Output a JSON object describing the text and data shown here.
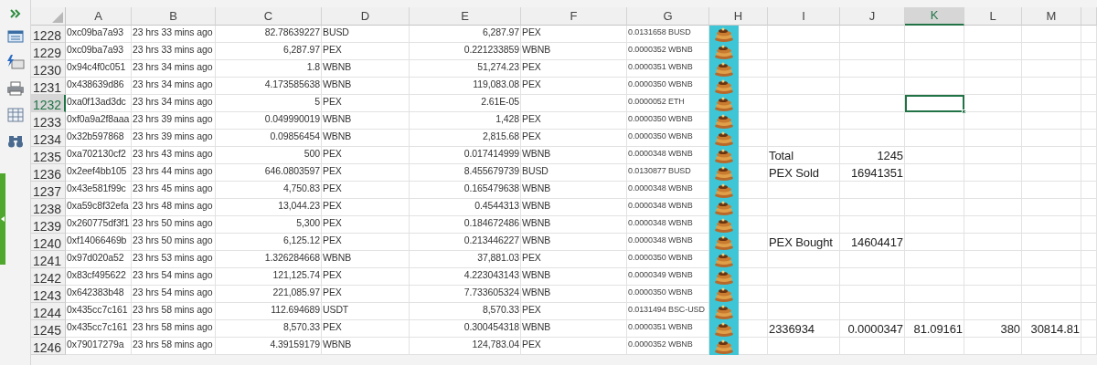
{
  "columns": [
    {
      "label": "A",
      "selected": false
    },
    {
      "label": "B",
      "selected": false
    },
    {
      "label": "C",
      "selected": false
    },
    {
      "label": "D",
      "selected": false
    },
    {
      "label": "E",
      "selected": false
    },
    {
      "label": "F",
      "selected": false
    },
    {
      "label": "G",
      "selected": false
    },
    {
      "label": "H",
      "selected": false
    },
    {
      "label": "I",
      "selected": false
    },
    {
      "label": "J",
      "selected": false
    },
    {
      "label": "K",
      "selected": true
    },
    {
      "label": "L",
      "selected": false
    },
    {
      "label": "M",
      "selected": false
    }
  ],
  "rows": [
    {
      "number": "1228",
      "selected": false,
      "cells": {
        "a": "0xc09ba7a93",
        "b": "23 hrs 33 mins ago",
        "c": "82.78639227",
        "d": "BUSD",
        "e": "6,287.97",
        "f": "PEX",
        "g": "0.0131658 BUSD"
      }
    },
    {
      "number": "1229",
      "selected": false,
      "cells": {
        "a": "0xc09ba7a93",
        "b": "23 hrs 33 mins ago",
        "c": "6,287.97",
        "d": "PEX",
        "e": "0.221233859",
        "f": "WBNB",
        "g": "0.0000352 WBNB"
      }
    },
    {
      "number": "1230",
      "selected": false,
      "cells": {
        "a": "0x94c4f0c051",
        "b": "23 hrs 34 mins ago",
        "c": "1.8",
        "d": "WBNB",
        "e": "51,274.23",
        "f": "PEX",
        "g": "0.0000351 WBNB"
      }
    },
    {
      "number": "1231",
      "selected": false,
      "cells": {
        "a": "0x438639d86",
        "b": "23 hrs 34 mins ago",
        "c": "4.173585638",
        "d": "WBNB",
        "e": "119,083.08",
        "f": "PEX",
        "g": "0.0000350 WBNB"
      }
    },
    {
      "number": "1232",
      "selected": true,
      "cells": {
        "a": "0xa0f13ad3dc",
        "b": "23 hrs 34 mins ago",
        "c": "5",
        "d": "PEX",
        "e": "2.61E-05",
        "g": "0.0000052 ETH"
      }
    },
    {
      "number": "1233",
      "selected": false,
      "cells": {
        "a": "0xf0a9a2f8aaa",
        "b": "23 hrs 39 mins ago",
        "c": "0.049990019",
        "d": "WBNB",
        "e": "1,428",
        "f": "PEX",
        "g": "0.0000350 WBNB"
      }
    },
    {
      "number": "1234",
      "selected": false,
      "cells": {
        "a": "0x32b597868",
        "b": "23 hrs 39 mins ago",
        "c": "0.09856454",
        "d": "WBNB",
        "e": "2,815.68",
        "f": "PEX",
        "g": "0.0000350 WBNB"
      }
    },
    {
      "number": "1235",
      "selected": false,
      "cells": {
        "a": "0xa702130cf2",
        "b": "23 hrs 43 mins ago",
        "c": "500",
        "d": "PEX",
        "e": "0.017414999",
        "f": "WBNB",
        "g": "0.0000348 WBNB",
        "i": "Total",
        "j": "1245"
      }
    },
    {
      "number": "1236",
      "selected": false,
      "cells": {
        "a": "0x2eef4bb105",
        "b": "23 hrs 44 mins ago",
        "c": "646.0803597",
        "d": "PEX",
        "e": "8.455679739",
        "f": "BUSD",
        "g": "0.0130877 BUSD",
        "i": "PEX Sold",
        "j": "16941351"
      }
    },
    {
      "number": "1237",
      "selected": false,
      "cells": {
        "a": "0x43e581f99c",
        "b": "23 hrs 45 mins ago",
        "c": "4,750.83",
        "d": "PEX",
        "e": "0.165479638",
        "f": "WBNB",
        "g": "0.0000348 WBNB"
      }
    },
    {
      "number": "1238",
      "selected": false,
      "cells": {
        "a": "0xa59c8f32efa",
        "b": "23 hrs 48 mins ago",
        "c": "13,044.23",
        "d": "PEX",
        "e": "0.4544313",
        "f": "WBNB",
        "g": "0.0000348 WBNB"
      }
    },
    {
      "number": "1239",
      "selected": false,
      "cells": {
        "a": "0x260775df3f1",
        "b": "23 hrs 50 mins ago",
        "c": "5,300",
        "d": "PEX",
        "e": "0.184672486",
        "f": "WBNB",
        "g": "0.0000348 WBNB"
      }
    },
    {
      "number": "1240",
      "selected": false,
      "cells": {
        "a": "0xf14066469b",
        "b": "23 hrs 50 mins ago",
        "c": "6,125.12",
        "d": "PEX",
        "e": "0.213446227",
        "f": "WBNB",
        "g": "0.0000348 WBNB",
        "i": "PEX Bought",
        "j": "14604417"
      }
    },
    {
      "number": "1241",
      "selected": false,
      "cells": {
        "a": "0x97d020a52",
        "b": "23 hrs 53 mins ago",
        "c": "1.326284668",
        "d": "WBNB",
        "e": "37,881.03",
        "f": "PEX",
        "g": "0.0000350 WBNB"
      }
    },
    {
      "number": "1242",
      "selected": false,
      "cells": {
        "a": "0x83cf495622",
        "b": "23 hrs 54 mins ago",
        "c": "121,125.74",
        "d": "PEX",
        "e": "4.223043143",
        "f": "WBNB",
        "g": "0.0000349 WBNB"
      }
    },
    {
      "number": "1243",
      "selected": false,
      "cells": {
        "a": "0x642383b48",
        "b": "23 hrs 54 mins ago",
        "c": "221,085.97",
        "d": "PEX",
        "e": "7.733605324",
        "f": "WBNB",
        "g": "0.0000350 WBNB"
      }
    },
    {
      "number": "1244",
      "selected": false,
      "cells": {
        "a": "0x435cc7c161",
        "b": "23 hrs 58 mins ago",
        "c": "112.694689",
        "d": "USDT",
        "e": "8,570.33",
        "f": "PEX",
        "g": "0.0131494 BSC-USD"
      }
    },
    {
      "number": "1245",
      "selected": false,
      "cells": {
        "a": "0x435cc7c161",
        "b": "23 hrs 58 mins ago",
        "c": "8,570.33",
        "d": "PEX",
        "e": "0.300454318",
        "f": "WBNB",
        "g": "0.0000351 WBNB",
        "i": "2336934",
        "j": "0.0000347",
        "k": "81.09161",
        "l": "380",
        "m": "30814.81"
      }
    },
    {
      "number": "1246",
      "selected": false,
      "cells": {
        "a": "0x79017279a",
        "b": "23 hrs 58 mins ago",
        "c": "4.39159179",
        "d": "WBNB",
        "e": "124,783.04",
        "f": "PEX",
        "g": "0.0000352 WBNB"
      }
    }
  ]
}
